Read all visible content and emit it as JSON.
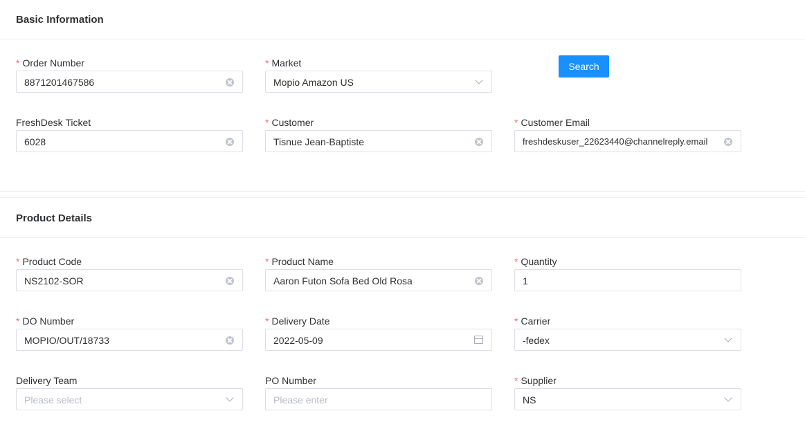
{
  "basic_info": {
    "title": "Basic Information",
    "search_label": "Search",
    "fields": {
      "order_number": {
        "label": "Order Number",
        "required": true,
        "value": "8871201467586"
      },
      "market": {
        "label": "Market",
        "required": true,
        "value": "Mopio Amazon US"
      },
      "freshdesk_ticket": {
        "label": "FreshDesk Ticket",
        "required": false,
        "value": "6028"
      },
      "customer": {
        "label": "Customer",
        "required": true,
        "value": "Tisnue Jean-Baptiste"
      },
      "customer_email": {
        "label": "Customer Email",
        "required": true,
        "value": "freshdeskuser_22623440@channelreply.email"
      }
    }
  },
  "product_details": {
    "title": "Product Details",
    "fields": {
      "product_code": {
        "label": "Product Code",
        "required": true,
        "value": "NS2102-SOR"
      },
      "product_name": {
        "label": "Product Name",
        "required": true,
        "value": "Aaron Futon Sofa Bed Old Rosa"
      },
      "quantity": {
        "label": "Quantity",
        "required": true,
        "value": "1"
      },
      "do_number": {
        "label": "DO Number",
        "required": true,
        "value": "MOPIO/OUT/18733"
      },
      "delivery_date": {
        "label": "Delivery Date",
        "required": true,
        "value": "2022-05-09"
      },
      "carrier": {
        "label": "Carrier",
        "required": true,
        "value": "-fedex"
      },
      "delivery_team": {
        "label": "Delivery Team",
        "required": false,
        "placeholder": "Please select"
      },
      "po_number": {
        "label": "PO Number",
        "required": false,
        "placeholder": "Please enter"
      },
      "supplier": {
        "label": "Supplier",
        "required": true,
        "value": "NS"
      }
    }
  },
  "colors": {
    "primary": "#1890ff",
    "required_mark": "#f56c6c",
    "border": "#dcdfe6"
  }
}
